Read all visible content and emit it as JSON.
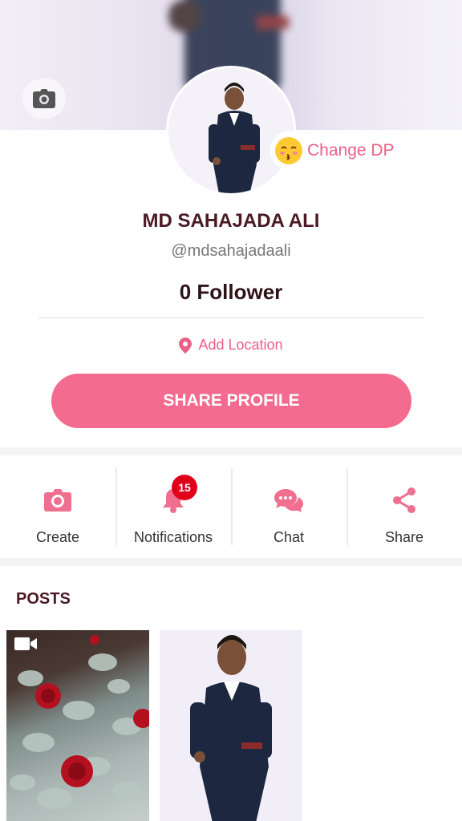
{
  "profile": {
    "name": "MD SAHAJADA ALI",
    "handle": "@mdsahajadaali",
    "followers": "0 Follower",
    "change_dp_label": "Change DP",
    "location_label": "Add Location",
    "share_profile_label": "SHARE PROFILE"
  },
  "actions": [
    {
      "label": "Create",
      "icon": "camera-icon"
    },
    {
      "label": "Notifications",
      "icon": "bell-icon",
      "badge": "15"
    },
    {
      "label": "Chat",
      "icon": "chat-bubbles-icon"
    },
    {
      "label": "Share",
      "icon": "share-icon"
    }
  ],
  "posts": {
    "title": "POSTS",
    "items": [
      {
        "type": "video",
        "icon": "video-camera-icon"
      },
      {
        "type": "image"
      }
    ]
  },
  "colors": {
    "accent": "#f36b8e",
    "accent_text": "#ec5f86",
    "badge": "#e0001c",
    "title": "#4a1a25"
  }
}
